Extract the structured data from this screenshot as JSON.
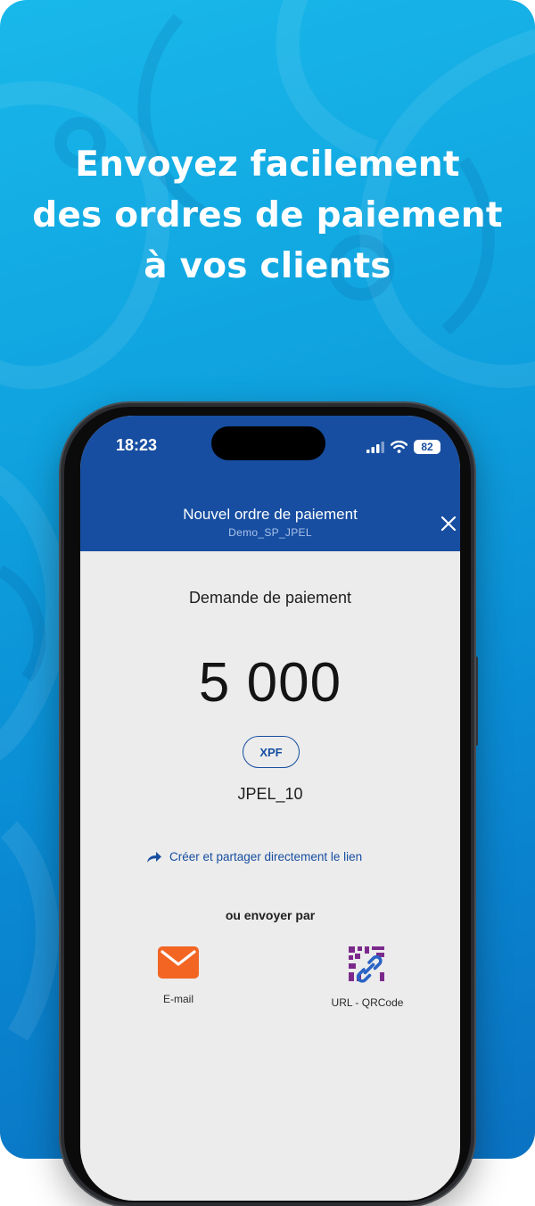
{
  "headline": {
    "line1": "Envoyez facilement",
    "line2": "des ordres de paiement",
    "line3": "à vos clients"
  },
  "status_bar": {
    "time": "18:23",
    "battery": "82",
    "icons": [
      "cellular-signal-icon",
      "wifi-icon",
      "battery-icon"
    ]
  },
  "nav": {
    "title": "Nouvel ordre de paiement",
    "subtitle": "Demo_SP_JPEL",
    "close_icon": "close-icon"
  },
  "payment": {
    "title": "Demande de paiement",
    "amount": "5 000",
    "currency": "XPF",
    "reference": "JPEL_10"
  },
  "actions": {
    "share_link_label": "Créer et partager directement le lien",
    "send_by_label": "ou envoyer par",
    "options": [
      {
        "label": "E-mail",
        "icon": "email-icon"
      },
      {
        "label": "URL - QRCode",
        "icon": "qr-link-icon"
      }
    ]
  },
  "colors": {
    "background_top": "#19b8ea",
    "background_bottom": "#0a72c2",
    "app_header": "#174ea1",
    "accent": "#174ea1",
    "email_icon": "#f26522",
    "qr_icon": "#7b2a8c"
  }
}
